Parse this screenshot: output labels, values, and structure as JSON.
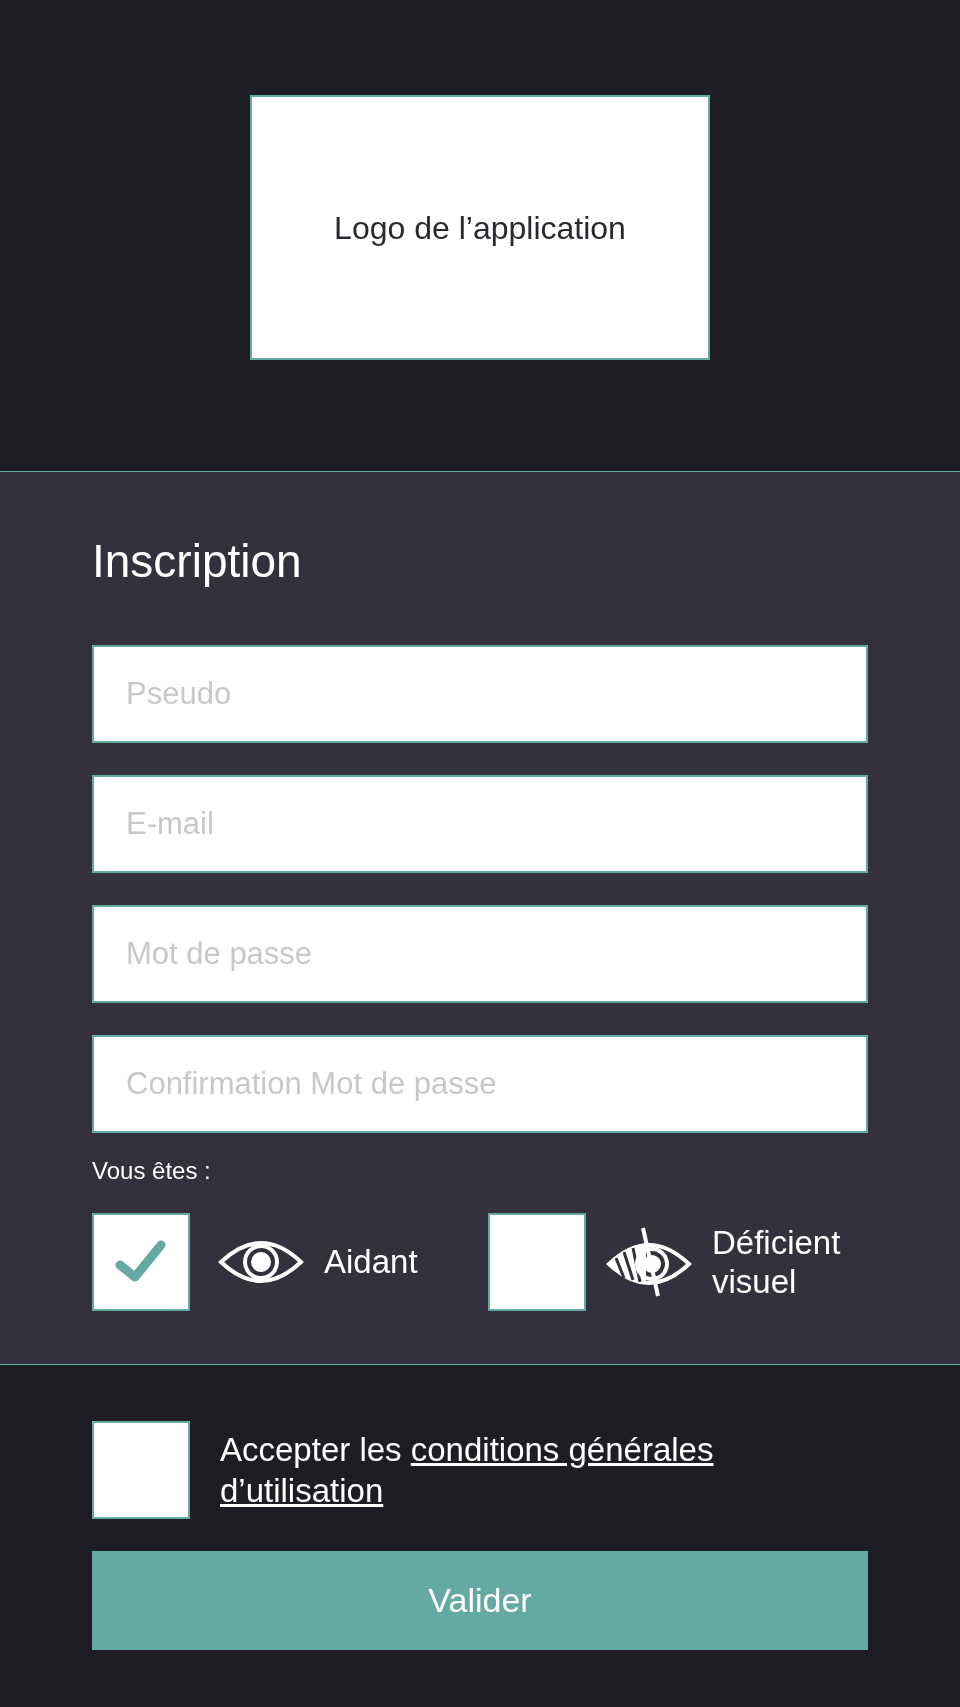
{
  "logo": {
    "label": "Logo de l’application"
  },
  "form": {
    "title": "Inscription",
    "fields": [
      {
        "placeholder": "Pseudo"
      },
      {
        "placeholder": "E-mail"
      },
      {
        "placeholder": "Mot de passe"
      },
      {
        "placeholder": "Confirmation Mot de passe"
      }
    ],
    "role_label": "Vous êtes :",
    "roles": [
      {
        "label": "Aidant",
        "kind": "sighted",
        "checked": true
      },
      {
        "label": "Déficient visuel",
        "kind": "impaired",
        "checked": false
      }
    ]
  },
  "terms": {
    "checked": false,
    "text": "Accepter les ",
    "link": [
      "conditions générales ",
      "d’utilisation"
    ]
  },
  "submit": {
    "label": "Valider"
  }
}
